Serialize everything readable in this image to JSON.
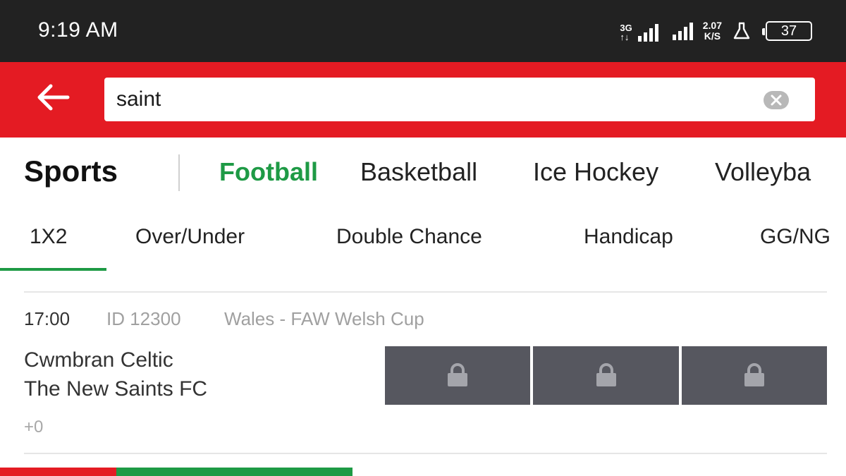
{
  "status_bar": {
    "time": "9:19 AM",
    "network_type_top": "3G",
    "network_type_bottom": "↑↓",
    "speed_value": "2.07",
    "speed_unit": "K/S",
    "battery": "37",
    "icons": [
      "signal-3g-icon",
      "signal-icon",
      "lab-flask-icon",
      "battery-icon"
    ]
  },
  "search": {
    "value": "saint",
    "back_icon": "arrow-left-icon",
    "clear_icon": "clear-circle-icon"
  },
  "sports": {
    "title": "Sports",
    "tabs": [
      {
        "label": "Football",
        "active": true
      },
      {
        "label": "Basketball",
        "active": false
      },
      {
        "label": "Ice Hockey",
        "active": false
      },
      {
        "label": "Volleyba",
        "active": false
      }
    ]
  },
  "markets": {
    "tabs": [
      {
        "label": "1X2",
        "active": true
      },
      {
        "label": "Over/Under",
        "active": false
      },
      {
        "label": "Double Chance",
        "active": false
      },
      {
        "label": "Handicap",
        "active": false
      },
      {
        "label": "GG/NG",
        "active": false
      }
    ]
  },
  "events": [
    {
      "time": "17:00",
      "id": "ID 12300",
      "league": "Wales - FAW Welsh Cup",
      "home": "Cwmbran Celtic",
      "away": "The New Saints FC",
      "more_markets": "+0",
      "odds": [
        "locked",
        "locked",
        "locked"
      ]
    }
  ],
  "colors": {
    "brand_red": "#e41b23",
    "accent_green": "#1e9a45",
    "locked_odds_bg": "#56575f",
    "status_bar_bg": "#222222"
  }
}
